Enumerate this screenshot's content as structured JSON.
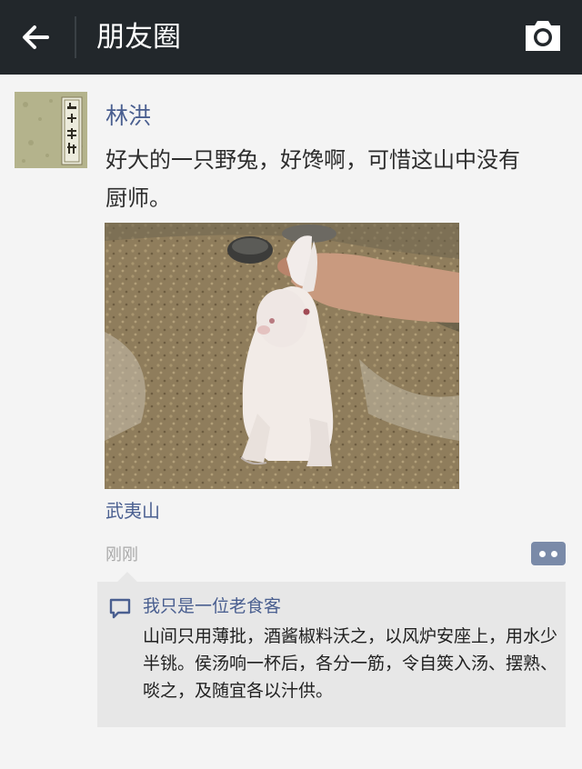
{
  "colors": {
    "topbar_bg": "#22272b",
    "page_bg": "#f4f4f4",
    "link": "#4a5f90",
    "time": "#a9a9a9",
    "comment_bg": "#e7e7e7",
    "more_button": "#7a8aa8"
  },
  "header": {
    "back_icon": "arrow-left-icon",
    "title": "朋友圈",
    "camera_icon": "camera-icon"
  },
  "post": {
    "avatar_icon": "book-cover-avatar",
    "author": "林洪",
    "text": "好大的一只野兔，好馋啊，可惜这山中没有厨师。",
    "photo_icon": "rabbit-photo",
    "location": "武夷山",
    "time": "刚刚",
    "more_icon": "more-dots-icon"
  },
  "comments": [
    {
      "author": "我只是一位老食客",
      "text": "山间只用薄批，酒酱椒料沃之，以风炉安座上，用水少半铫。侯汤响一杯后，各分一筋，令自筴入汤、摆熟、啖之，及随宜各以汁供。",
      "icon": "comment-bubble-icon"
    }
  ]
}
